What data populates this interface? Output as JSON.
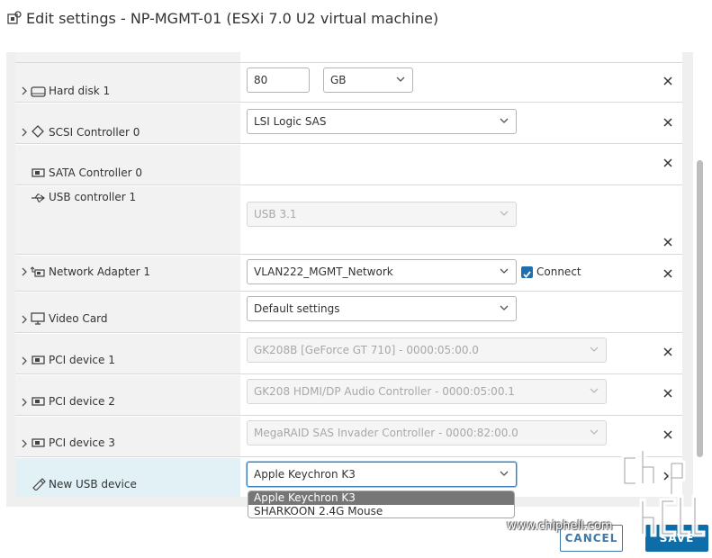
{
  "dialog": {
    "title": "Edit settings - NP-MGMT-01 (ESXi 7.0 U2 virtual machine)"
  },
  "devices": {
    "hard_disk": {
      "label": "Hard disk 1",
      "size": "80",
      "unit": "GB"
    },
    "scsi": {
      "label": "SCSI Controller 0",
      "value": "LSI Logic SAS"
    },
    "sata": {
      "label": "SATA Controller 0"
    },
    "usb_controller": {
      "label": "USB controller 1",
      "value": "USB 3.1"
    },
    "network": {
      "label": "Network Adapter 1",
      "value": "VLAN222_MGMT_Network",
      "connect_label": "Connect",
      "connected": true
    },
    "video": {
      "label": "Video Card",
      "value": "Default settings"
    },
    "pci1": {
      "label": "PCI device 1",
      "value": "GK208B [GeForce GT 710] - 0000:05:00.0"
    },
    "pci2": {
      "label": "PCI device 2",
      "value": "GK208 HDMI/DP Audio Controller - 0000:05:00.1"
    },
    "pci3": {
      "label": "PCI device 3",
      "value": "MegaRAID SAS Invader Controller - 0000:82:00.0"
    },
    "new_usb": {
      "label": "New USB device",
      "value": "Apple Keychron K3"
    }
  },
  "usb_dropdown": {
    "options": [
      "Apple Keychron K3",
      "SHARKOON 2.4G Mouse"
    ],
    "selected_index": 0
  },
  "footer": {
    "cancel_label": "CANCEL",
    "save_label": "SAVE"
  },
  "watermark": {
    "url": "www.chiphell.com"
  },
  "colors": {
    "accent": "#0e6ca8",
    "highlight_row": "#e1f1f6",
    "selected_option": "#767676"
  },
  "icons": [
    "vm-settings-icon",
    "chevron-right-icon",
    "hard-disk-icon",
    "scsi-controller-icon",
    "sata-controller-icon",
    "usb-icon",
    "network-adapter-icon",
    "monitor-icon",
    "pci-card-icon",
    "usb-plug-icon",
    "chevron-down-icon",
    "close-icon",
    "checkbox-checked-icon"
  ]
}
